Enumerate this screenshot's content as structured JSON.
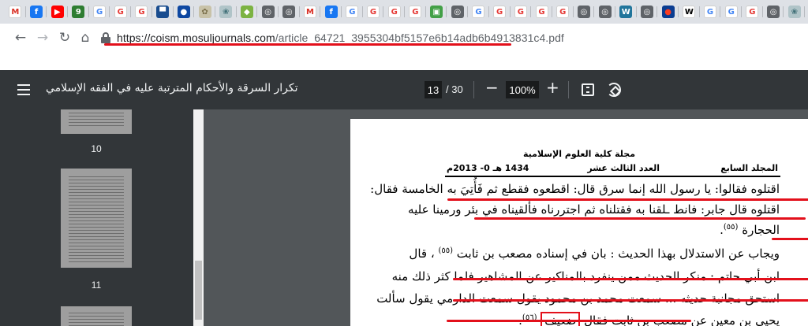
{
  "tabs": {
    "favicons": [
      {
        "icon": "gmail-icon",
        "glyph": "M",
        "color": "#ffffff",
        "fg": "#d93025"
      },
      {
        "icon": "facebook-icon",
        "glyph": "f",
        "color": "#1877f2",
        "fg": "#ffffff"
      },
      {
        "icon": "youtube-icon",
        "glyph": "▶",
        "color": "#ff0000",
        "fg": "#ffffff"
      },
      {
        "icon": "app-green-icon",
        "glyph": "9",
        "color": "#2e7d32",
        "fg": "#ffffff"
      },
      {
        "icon": "google-icon",
        "glyph": "G",
        "color": "#ffffff",
        "fg": "#4285f4"
      },
      {
        "icon": "red-g-icon",
        "glyph": "G",
        "color": "#ffffff",
        "fg": "#e53935"
      },
      {
        "icon": "red-g-icon",
        "glyph": "G",
        "color": "#ffffff",
        "fg": "#e53935"
      },
      {
        "icon": "flag-icon",
        "glyph": "▀",
        "color": "#1a4d8f",
        "fg": "#ffffff"
      },
      {
        "icon": "seal-icon",
        "glyph": "●",
        "color": "#0d47a1",
        "fg": "#ffffff"
      },
      {
        "icon": "emblem-icon",
        "glyph": "✿",
        "color": "#c8c2a8",
        "fg": "#7a6f4a"
      },
      {
        "icon": "globe-icon",
        "glyph": "❀",
        "color": "#b0c4c8",
        "fg": "#3e6e76"
      },
      {
        "icon": "leaf-icon",
        "glyph": "◆",
        "color": "#7cb342",
        "fg": "#ffffff"
      },
      {
        "icon": "world-icon",
        "glyph": "◎",
        "color": "#5f6368",
        "fg": "#ffffff"
      },
      {
        "icon": "world-icon",
        "glyph": "◎",
        "color": "#5f6368",
        "fg": "#ffffff"
      },
      {
        "icon": "gmail-icon",
        "glyph": "M",
        "color": "#ffffff",
        "fg": "#d93025"
      },
      {
        "icon": "facebook-icon",
        "glyph": "f",
        "color": "#1877f2",
        "fg": "#ffffff"
      },
      {
        "icon": "google-icon",
        "glyph": "G",
        "color": "#ffffff",
        "fg": "#4285f4"
      },
      {
        "icon": "red-g-icon",
        "glyph": "G",
        "color": "#ffffff",
        "fg": "#e53935"
      },
      {
        "icon": "red-g-icon",
        "glyph": "G",
        "color": "#ffffff",
        "fg": "#e53935"
      },
      {
        "icon": "red-g-icon",
        "glyph": "G",
        "color": "#ffffff",
        "fg": "#e53935"
      },
      {
        "icon": "sheet-icon",
        "glyph": "▣",
        "color": "#43a047",
        "fg": "#ffffff"
      },
      {
        "icon": "world-icon",
        "glyph": "◎",
        "color": "#5f6368",
        "fg": "#ffffff"
      },
      {
        "icon": "google-icon",
        "glyph": "G",
        "color": "#ffffff",
        "fg": "#4285f4"
      },
      {
        "icon": "red-g-icon",
        "glyph": "G",
        "color": "#ffffff",
        "fg": "#e53935"
      },
      {
        "icon": "red-g-icon",
        "glyph": "G",
        "color": "#ffffff",
        "fg": "#e53935"
      },
      {
        "icon": "red-g-icon",
        "glyph": "G",
        "color": "#ffffff",
        "fg": "#e53935"
      },
      {
        "icon": "red-g-icon",
        "glyph": "G",
        "color": "#ffffff",
        "fg": "#e53935"
      },
      {
        "icon": "world-icon",
        "glyph": "◎",
        "color": "#5f6368",
        "fg": "#ffffff"
      },
      {
        "icon": "world-icon",
        "glyph": "◎",
        "color": "#5f6368",
        "fg": "#ffffff"
      },
      {
        "icon": "wordpress-icon",
        "glyph": "W",
        "color": "#21759b",
        "fg": "#ffffff"
      },
      {
        "icon": "world-icon",
        "glyph": "◎",
        "color": "#5f6368",
        "fg": "#ffffff"
      },
      {
        "icon": "nasa-icon",
        "glyph": "●",
        "color": "#0b3d91",
        "fg": "#fc3d21"
      },
      {
        "icon": "wikipedia-icon",
        "glyph": "W",
        "color": "#ffffff",
        "fg": "#000000"
      },
      {
        "icon": "google-icon",
        "glyph": "G",
        "color": "#ffffff",
        "fg": "#4285f4"
      },
      {
        "icon": "google-icon",
        "glyph": "G",
        "color": "#ffffff",
        "fg": "#4285f4"
      },
      {
        "icon": "red-g-icon",
        "glyph": "G",
        "color": "#ffffff",
        "fg": "#e53935"
      },
      {
        "icon": "world-icon",
        "glyph": "◎",
        "color": "#5f6368",
        "fg": "#ffffff"
      },
      {
        "icon": "emblem-icon",
        "glyph": "❀",
        "color": "#b0c4c8",
        "fg": "#3e6e76"
      }
    ]
  },
  "address_bar": {
    "url_host": "https://coism.mosuljournals.com",
    "url_path": "/article_64721_3955304bf5157e6b14adb6b4913831c4.pdf"
  },
  "pdf_viewer": {
    "title": "تكرار السرقة والأحكام المترتبة عليه في الفقه الإسلامي",
    "current_page": "13",
    "total_pages": "/ 30",
    "zoom": "100%",
    "zoom_out": "−",
    "zoom_in": "+"
  },
  "thumbnails": [
    {
      "label": "10"
    },
    {
      "label": "11"
    }
  ],
  "page": {
    "journal_name": "مجلة كلية العلوم الإسلامية",
    "volume": "المجلد السابع",
    "issue": "العدد الثالث عشر",
    "date": "1434 هـ 0- 2013م",
    "lines": [
      "اقتلوه فقالوا: يا رسول الله إنما سرق قال: اقطعوه فقطع ثم فَأُتِيَ به الخامسة فقال:",
      "اقتلوه قال جابر: فانط ـلقنا به فقتلناه ثم اجتررناه فألقيناه في بئر ورمينا عليه",
      "الحجارة",
      "ويجاب عن الاستدلال بهذا الحديث : بان في إسناده مصعب بن ثابت",
      "، قال",
      "ابن أبي حاتم : منكر الحديث ممن ينفرد بالمناكير عن المشاهير فلما كثر ذلك منه",
      "استحق مجانبة حديثه ... سمعت محمد بن محمود يقول سمعت الدارمي يقول سألت",
      "يحيى بن معين عن مصعب بن ثابت فقال",
      "ضعيف",
      "(٥٥)",
      "(٥٦)",
      "(٥٥)"
    ]
  },
  "colors": {
    "annotation_red": "#e3101b",
    "viewer_bg": "#525659",
    "toolbar_bg": "#323639"
  }
}
